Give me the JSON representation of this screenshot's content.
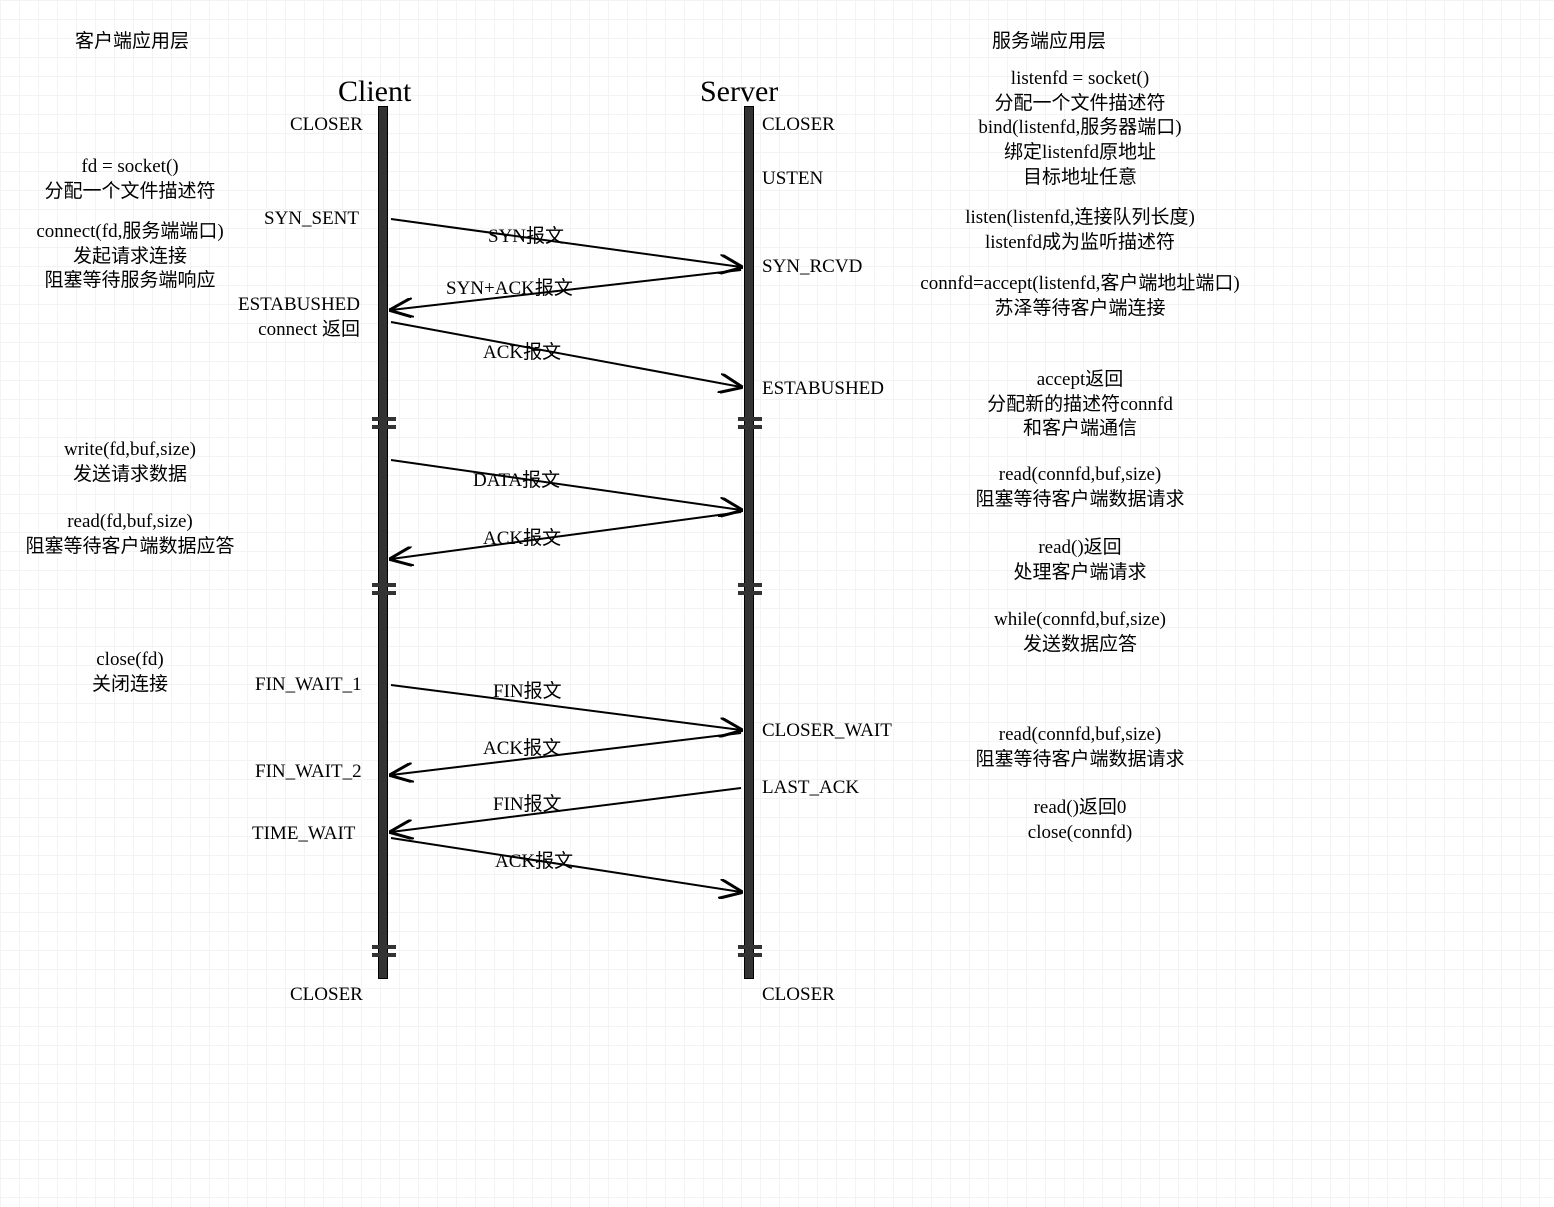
{
  "title_client": "Client",
  "title_server": "Server",
  "header_client_app": "客户端应用层",
  "header_server_app": "服务端应用层",
  "client_app": {
    "socket": "fd = socket()\n分配一个文件描述符",
    "connect": "connect(fd,服务端端口)\n发起请求连接\n阻塞等待服务端响应",
    "write": "write(fd,buf,size)\n发送请求数据",
    "read": "read(fd,buf,size)\n阻塞等待客户端数据应答",
    "close": "close(fd)\n关闭连接"
  },
  "server_app": {
    "socket": "listenfd = socket()\n分配一个文件描述符\nbind(listenfd,服务器端口)\n绑定listenfd原地址\n目标地址任意",
    "listen": "listen(listenfd,连接队列长度)\nlistenfd成为监听描述符",
    "accept": "connfd=accept(listenfd,客户端地址端口)\n苏泽等待客户端连接",
    "accept_ret": "accept返回\n分配新的描述符connfd\n和客户端通信",
    "read1": "read(connfd,buf,size)\n阻塞等待客户端数据请求",
    "read_ret": "read()返回\n处理客户端请求",
    "while": "while(connfd,buf,size)\n发送数据应答",
    "read2": "read(connfd,buf,size)\n阻塞等待客户端数据请求",
    "read0": "read()返回0\nclose(connfd)"
  },
  "states_client": {
    "closer_top": "CLOSER",
    "syn_sent": "SYN_SENT",
    "established": "ESTABUSHED\nconnect 返回",
    "fin_wait_1": "FIN_WAIT_1",
    "fin_wait_2": "FIN_WAIT_2",
    "time_wait": "TIME_WAIT",
    "closer_bot": "CLOSER"
  },
  "states_server": {
    "closer_top": "CLOSER",
    "usten": "USTEN",
    "syn_rcvd": "SYN_RCVD",
    "established": "ESTABUSHED",
    "closer_wait": "CLOSER_WAIT",
    "last_ack": "LAST_ACK",
    "closer_bot": "CLOSER"
  },
  "messages": {
    "syn": "SYN报文",
    "syn_ack": "SYN+ACK报文",
    "ack1": "ACK报文",
    "data": "DATA报文",
    "ack2": "ACK报文",
    "fin1": "FIN报文",
    "ack3": "ACK报文",
    "fin2": "FIN报文",
    "ack4": "ACK报文"
  }
}
